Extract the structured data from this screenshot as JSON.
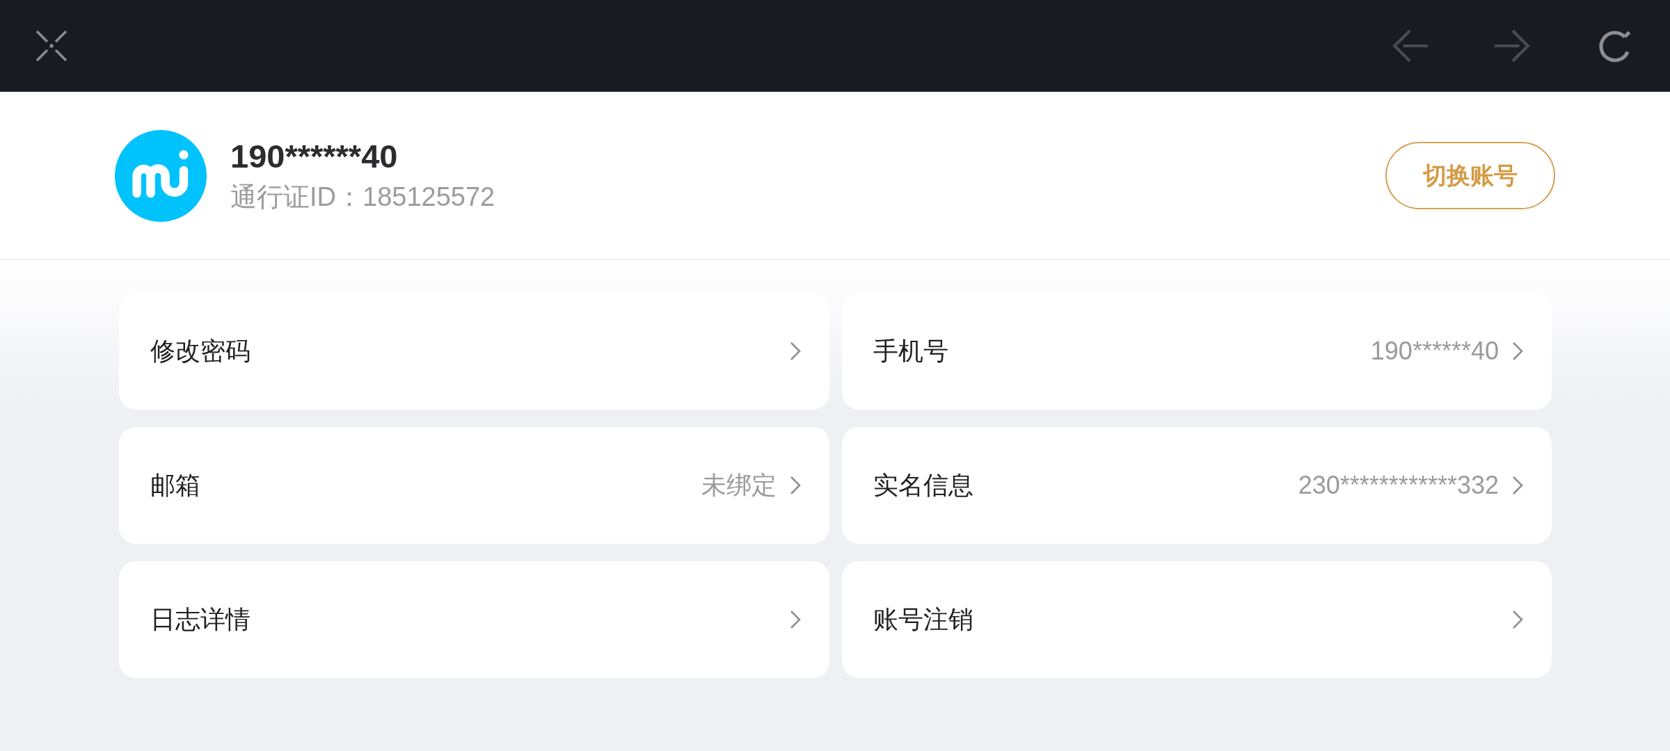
{
  "toolbar": {
    "back": {
      "disabled": true
    },
    "forward": {
      "disabled": true
    }
  },
  "account": {
    "name": "190******40",
    "pass_id": "通行证ID：185125572",
    "switch_button": "切换账号"
  },
  "settings": [
    {
      "label": "修改密码"
    },
    {
      "label": "手机号",
      "value": "190******40"
    },
    {
      "label": "邮箱",
      "value": "未绑定"
    },
    {
      "label": "实名信息",
      "value": "230************332"
    },
    {
      "label": "日志详情"
    },
    {
      "label": "账号注销"
    }
  ]
}
